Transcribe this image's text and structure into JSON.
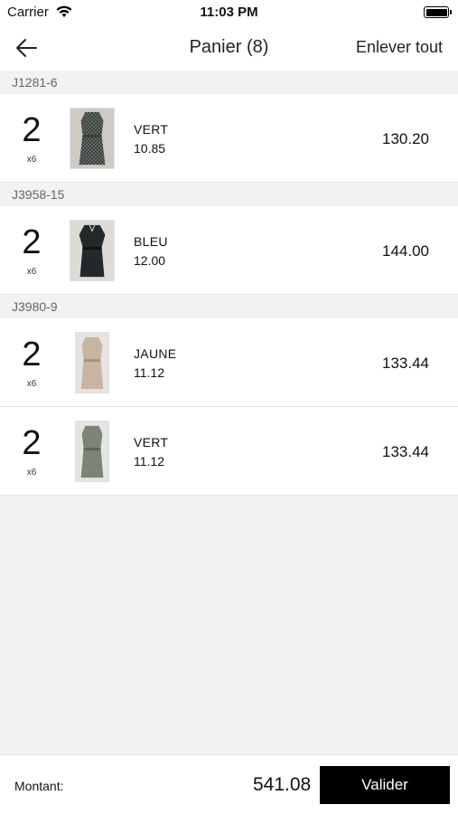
{
  "status_bar": {
    "carrier": "Carrier",
    "time": "11:03 PM",
    "wifi_icon": "wifi-icon",
    "battery_icon": "battery-icon",
    "battery_level": 1.0
  },
  "nav": {
    "back_icon": "arrow-left-icon",
    "title": "Panier (8)",
    "clear_label": "Enlever tout"
  },
  "groups": [
    {
      "reference": "J1281-6",
      "items": [
        {
          "quantity": "2",
          "multiplier": "x6",
          "color": "VERT",
          "unit_price": "10.85",
          "total": "130.20",
          "thumb_icon": "dress-thumbnail"
        }
      ]
    },
    {
      "reference": "J3958-15",
      "items": [
        {
          "quantity": "2",
          "multiplier": "x6",
          "color": "BLEU",
          "unit_price": "12.00",
          "total": "144.00",
          "thumb_icon": "dress-thumbnail"
        }
      ]
    },
    {
      "reference": "J3980-9",
      "items": [
        {
          "quantity": "2",
          "multiplier": "x6",
          "color": "JAUNE",
          "unit_price": "11.12",
          "total": "133.44",
          "thumb_icon": "dress-thumbnail"
        },
        {
          "quantity": "2",
          "multiplier": "x6",
          "color": "VERT",
          "unit_price": "11.12",
          "total": "133.44",
          "thumb_icon": "dress-thumbnail"
        }
      ]
    }
  ],
  "footer": {
    "amount_label": "Montant:",
    "amount_value": "541.08",
    "validate_label": "Valider"
  },
  "colors": {
    "background": "#f2f2f2",
    "surface": "#ffffff",
    "button": "#000000",
    "button_text": "#ffffff",
    "header_text": "#666666"
  }
}
